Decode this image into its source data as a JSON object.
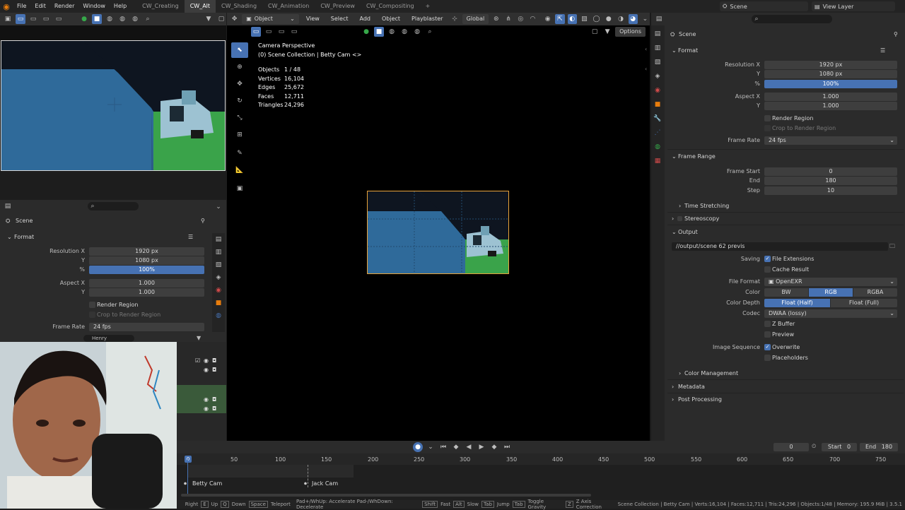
{
  "menu": {
    "items": [
      "File",
      "Edit",
      "Render",
      "Window",
      "Help"
    ]
  },
  "workspaces": [
    {
      "label": "CW_Creating",
      "active": false
    },
    {
      "label": "CW_Alt",
      "active": true
    },
    {
      "label": "CW_Shading",
      "active": false
    },
    {
      "label": "CW_Animation",
      "active": false
    },
    {
      "label": "CW_Preview",
      "active": false
    },
    {
      "label": "CW_Compositing",
      "active": false
    }
  ],
  "topright": {
    "scene": "Scene",
    "view_layer": "View Layer"
  },
  "viewport_header": {
    "mode": "Object Mode",
    "menus": [
      "View",
      "Select",
      "Add",
      "Object",
      "Playblaster"
    ],
    "transform": "Global",
    "options": "Options"
  },
  "overlay": {
    "title": "Camera Perspective",
    "collection": "(0) Scene Collection | Betty Cam <>",
    "stats": [
      {
        "label": "Objects",
        "value": "1 / 48"
      },
      {
        "label": "Vertices",
        "value": "16,104"
      },
      {
        "label": "Edges",
        "value": "25,672"
      },
      {
        "label": "Faces",
        "value": "12,711"
      },
      {
        "label": "Triangles",
        "value": "24,296"
      }
    ]
  },
  "left_props": {
    "scene": "Scene",
    "format": "Format",
    "res_x_label": "Resolution X",
    "res_x": "1920 px",
    "res_y_label": "Y",
    "res_y": "1080 px",
    "pct_label": "%",
    "pct": "100%",
    "aspect_x_label": "Aspect X",
    "aspect_x": "1.000",
    "aspect_y_label": "Y",
    "aspect_y": "1.000",
    "render_region": "Render Region",
    "crop": "Crop to Render Region",
    "frame_rate_label": "Frame Rate",
    "frame_rate": "24 fps",
    "outliner_search": "Henry"
  },
  "props": {
    "scene": "Scene",
    "format": "Format",
    "res_x_label": "Resolution X",
    "res_x": "1920 px",
    "res_y_label": "Y",
    "res_y": "1080 px",
    "pct_label": "%",
    "pct": "100%",
    "aspect_x_label": "Aspect X",
    "aspect_x": "1.000",
    "aspect_y_label": "Y",
    "aspect_y": "1.000",
    "render_region": "Render Region",
    "crop": "Crop to Render Region",
    "frame_rate_label": "Frame Rate",
    "frame_rate": "24 fps",
    "frame_range": "Frame Range",
    "frame_start_label": "Frame Start",
    "frame_start": "0",
    "end_label": "End",
    "end": "180",
    "step_label": "Step",
    "step": "10",
    "time_stretching": "Time Stretching",
    "stereoscopy": "Stereoscopy",
    "output": "Output",
    "output_path": "//output/scene 62 previs",
    "saving_label": "Saving",
    "file_extensions": "File Extensions",
    "cache_result": "Cache Result",
    "file_format_label": "File Format",
    "file_format": "OpenEXR",
    "color_label": "Color",
    "color_bw": "BW",
    "color_rgb": "RGB",
    "color_rgba": "RGBA",
    "depth_label": "Color Depth",
    "depth_half": "Float (Half)",
    "depth_full": "Float (Full)",
    "codec_label": "Codec",
    "codec": "DWAA (lossy)",
    "z_buffer": "Z Buffer",
    "preview": "Preview",
    "image_sequence_label": "Image Sequence",
    "overwrite": "Overwrite",
    "placeholders": "Placeholders",
    "color_management": "Color Management",
    "metadata": "Metadata",
    "post_processing": "Post Processing"
  },
  "timeline": {
    "current_frame": "0",
    "start_label": "Start",
    "start": "0",
    "end_label": "End",
    "end": "180",
    "ticks": [
      "0",
      "50",
      "100",
      "150",
      "200",
      "250",
      "300",
      "350",
      "400",
      "450",
      "500",
      "550",
      "600",
      "650",
      "700",
      "750"
    ],
    "markers": [
      "Betty Cam",
      "Jack Cam"
    ]
  },
  "status": {
    "items": [
      "Right",
      "Up",
      "Down",
      "Teleport",
      "Pad+/WhUp: Accelerate Pad-/WhDown: Decelerate",
      "Fast",
      "Slow",
      "Jump",
      "Toggle Gravity",
      "Z Axis Correction"
    ],
    "keys": [
      "E",
      "Q",
      "Space",
      "Shift",
      "Alt",
      "Tab",
      "Z"
    ],
    "right": "Scene Collection | Betty Cam | Verts:16,104 | Faces:12,711 | Tris:24,296 | Objects:1/48 | Memory: 195.9 MiB | 3.5.1"
  },
  "colors": {
    "accent": "#4772b3",
    "brand": "#e87d0d",
    "scene_blue": "#2f6a9a",
    "grass": "#36a84a"
  }
}
